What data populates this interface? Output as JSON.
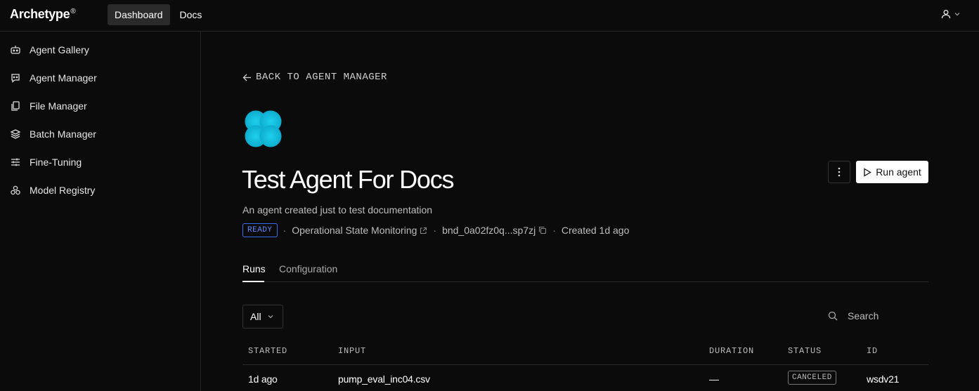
{
  "app": {
    "logo": "Archetype",
    "logo_mark": "®"
  },
  "nav": {
    "dashboard": "Dashboard",
    "docs": "Docs"
  },
  "sidebar": {
    "items": [
      {
        "label": "Agent Gallery",
        "icon": "robot-icon"
      },
      {
        "label": "Agent Manager",
        "icon": "chat-bot-icon"
      },
      {
        "label": "File Manager",
        "icon": "files-icon"
      },
      {
        "label": "Batch Manager",
        "icon": "layers-icon"
      },
      {
        "label": "Fine-Tuning",
        "icon": "sliders-icon"
      },
      {
        "label": "Model Registry",
        "icon": "cubes-icon"
      }
    ]
  },
  "page": {
    "back_label": "BACK TO AGENT MANAGER",
    "title": "Test Agent For Docs",
    "description": "An agent created just to test documentation",
    "status": "READY",
    "source": "Operational State Monitoring",
    "bundle_id": "bnd_0a02fz0q...sp7zj",
    "created": "Created 1d ago",
    "run_button": "Run agent",
    "accent_color": "#3b6df0"
  },
  "tabs": {
    "runs": "Runs",
    "configuration": "Configuration"
  },
  "filter": {
    "selected": "All"
  },
  "search": {
    "placeholder": "Search"
  },
  "table": {
    "headers": {
      "started": "STARTED",
      "input": "INPUT",
      "duration": "DURATION",
      "status": "STATUS",
      "id": "ID"
    },
    "rows": [
      {
        "started": "1d ago",
        "input": "pump_eval_inc04.csv",
        "duration": "—",
        "status": "CANCELED",
        "id": "wsdv21"
      }
    ]
  }
}
